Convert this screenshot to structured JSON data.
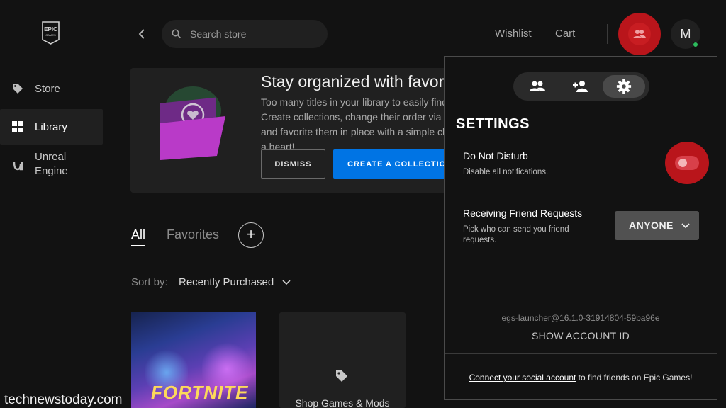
{
  "sidebar": {
    "logo_text": "EPIC GAMES",
    "items": [
      {
        "label": "Store",
        "icon": "tag-icon"
      },
      {
        "label": "Library",
        "icon": "grid-icon"
      },
      {
        "label": "Unreal Engine",
        "icon": "unreal-icon"
      }
    ]
  },
  "header": {
    "search_placeholder": "Search store",
    "wishlist": "Wishlist",
    "cart": "Cart",
    "avatar_initial": "M"
  },
  "banner": {
    "title": "Stay organized with favorites",
    "text": "Too many titles in your library to easily find? Create collections, change their order via drag, and favorite them in place with a simple click of a heart!",
    "dismiss": "DISMISS",
    "create": "CREATE A COLLECTION"
  },
  "tabs": {
    "all": "All",
    "favorites": "Favorites"
  },
  "sort": {
    "label": "Sort by:",
    "value": "Recently Purchased"
  },
  "cards": {
    "game_title": "FORTNITE",
    "shop_label": "Shop Games & Mods"
  },
  "watermark": "technewstoday.com",
  "settings": {
    "title": "SETTINGS",
    "dnd_title": "Do Not Disturb",
    "dnd_desc": "Disable all notifications.",
    "dnd_enabled": true,
    "fr_title": "Receiving Friend Requests",
    "fr_desc": "Pick who can send you friend requests.",
    "fr_value": "ANYONE",
    "version": "egs-launcher@16.1.0-31914804-59ba96e",
    "show_id": "SHOW ACCOUNT ID",
    "social_link": "Connect your social account",
    "social_rest": " to find friends on Epic Games!"
  },
  "colors": {
    "background": "#121212",
    "panel": "#202020",
    "accent_blue": "#0074e4",
    "highlight_red": "#b9151b",
    "toggle_on": "#d8404a",
    "online": "#2dbb5d"
  }
}
